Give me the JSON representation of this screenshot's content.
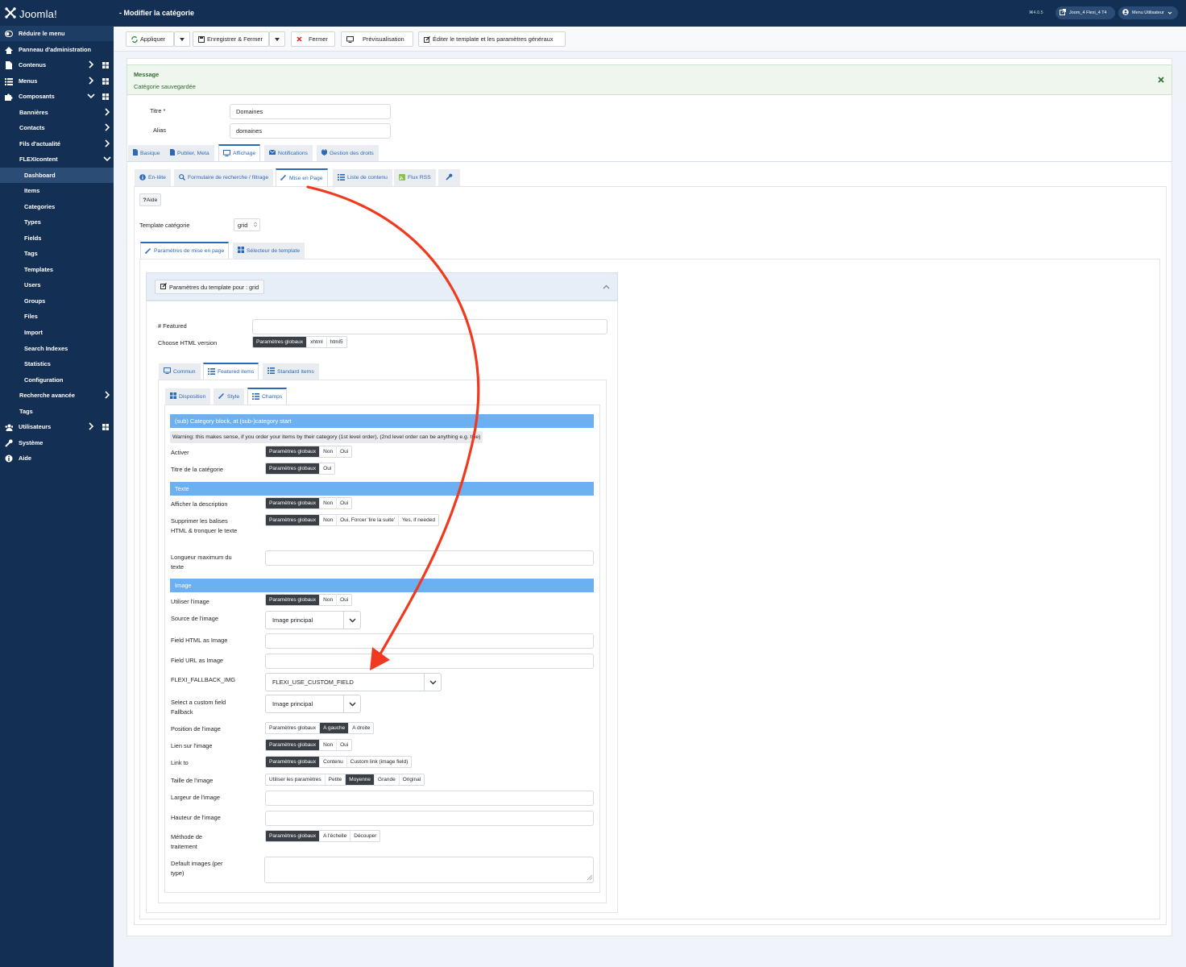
{
  "header": {
    "title": "- Modifier la catégorie",
    "version": "⌘4.0.5",
    "site_button": "Joom_4 Flexi_4 T4",
    "user_menu": "Menu Utilisateur"
  },
  "sidebar": {
    "logo": "Joomla!",
    "items": [
      {
        "label": "Réduire le menu",
        "icon": "toggle-icon"
      },
      {
        "label": "Panneau d'administration",
        "icon": "home-icon"
      },
      {
        "label": "Contenus",
        "icon": "file-icon"
      },
      {
        "label": "Menus",
        "icon": "list-icon"
      },
      {
        "label": "Composants",
        "icon": "puzzle-icon"
      },
      {
        "label": "Bannières"
      },
      {
        "label": "Contacts"
      },
      {
        "label": "Fils d'actualité"
      },
      {
        "label": "FLEXIcontent"
      },
      {
        "label": "Dashboard"
      },
      {
        "label": "Items"
      },
      {
        "label": "Categories"
      },
      {
        "label": "Types"
      },
      {
        "label": "Fields"
      },
      {
        "label": "Tags"
      },
      {
        "label": "Templates"
      },
      {
        "label": "Users"
      },
      {
        "label": "Groups"
      },
      {
        "label": "Files"
      },
      {
        "label": "Import"
      },
      {
        "label": "Search Indexes"
      },
      {
        "label": "Statistics"
      },
      {
        "label": "Configuration"
      },
      {
        "label": "Recherche avancée"
      },
      {
        "label": "Tags"
      },
      {
        "label": "Utilisateurs",
        "icon": "users-icon"
      },
      {
        "label": "Système",
        "icon": "wrench-icon"
      },
      {
        "label": "Aide",
        "icon": "info-icon"
      }
    ]
  },
  "toolbar": {
    "apply": "Appliquer",
    "save_close": "Enregistrer & Fermer",
    "close": "Fermer",
    "preview": "Prévisualisation",
    "edit_template": "Éditer le template et les paramètres généraux"
  },
  "message": {
    "title": "Message",
    "text": "Catégorie sauvegardée"
  },
  "form": {
    "title_label": "Titre *",
    "title_value": "Domaines",
    "alias_label": "Alias",
    "alias_value": "domaines"
  },
  "main_tabs": [
    "Basique",
    "Publier, Meta",
    "Affichage",
    "Notifications",
    "Gestion des droits"
  ],
  "sub_tabs": [
    "En-tête",
    "Formulaire de recherche / filtrage",
    "Mise en Page",
    "Liste de contenu",
    "Flux RSS"
  ],
  "help_button": "Aide",
  "template_label": "Template catégorie",
  "template_value": "grid",
  "layout_tabs": [
    "Paramètres de mise en page",
    "Sélecteur de template"
  ],
  "template_params_title": "Paramètres du template pour : grid",
  "featured_label": "# Featured",
  "html_version_label": "Choose HTML version",
  "html_version_options": [
    "Paramètres globaux",
    "xhtml",
    "html5"
  ],
  "items_tabs": [
    "Commun",
    "Featured items",
    "Standard items"
  ],
  "fi_tabs": [
    "Disposition",
    "Style",
    "Champs"
  ],
  "sections": {
    "subcat": "(sub) Category block, at (sub-)category start",
    "warning": "Warning: this makes sense, if you order your items by their category (1st level order), (2nd level order can be anything e.g. title)",
    "texte": "Texte",
    "image": "Image"
  },
  "fields": {
    "activer": "Activer",
    "titre_cat": "Titre de la catégorie",
    "afficher_desc": "Afficher la description",
    "supprimer": "Supprimer les balises HTML & tronquer le texte",
    "longueur": "Longueur maximum du texte",
    "utiliser_image": "Utiliser l'image",
    "source_image": "Source de l'image",
    "field_html": "Field HTML as Image",
    "field_url": "Field URL as Image",
    "fallback": "FLEXI_FALLBACK_IMG",
    "custom_fallback": "Select a custom field Fallback",
    "position": "Position de l'image",
    "lien": "Lien sur l'image",
    "link_to": "Link to",
    "taille": "Taille de l'image",
    "largeur": "Largeur de l'image",
    "hauteur": "Hauteur de l'image",
    "methode": "Méthode de traitement",
    "default_images": "Default images (per type)"
  },
  "options": {
    "global": "Paramètres globaux",
    "non": "Non",
    "oui": "Oui",
    "oui_forcer": "Oui, Forcer 'lire la suite'",
    "yes_if_needed": "Yes, if needed",
    "image_principal": "Image principal",
    "fallback_value": "FLEXI_USE_CUSTOM_FIELD",
    "a_gauche": "A gauche",
    "a_droite": "A droite",
    "contenu": "Contenu",
    "custom_link": "Custom link (image field)",
    "utiliser_params": "Utiliser les paramètres",
    "petite": "Petite",
    "moyenne": "Moyenne",
    "grande": "Grande",
    "original": "Original",
    "echelle": "A l'échelle",
    "decouper": "Découper"
  },
  "colors": {
    "sidebar": "#132f53",
    "accent": "#2a69b8",
    "section": "#6ab0f3",
    "arrow": "#f0391f"
  }
}
